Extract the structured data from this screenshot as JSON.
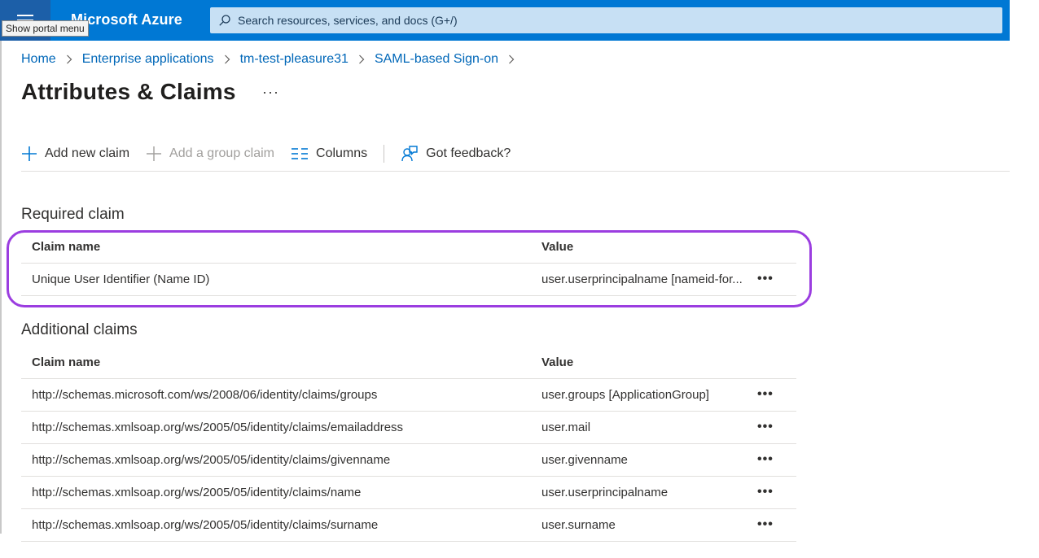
{
  "topbar": {
    "brand": "Microsoft Azure",
    "tooltip": "Show portal menu",
    "search_placeholder": "Search resources, services, and docs (G+/)"
  },
  "breadcrumb": [
    {
      "label": "Home"
    },
    {
      "label": "Enterprise applications"
    },
    {
      "label": "tm-test-pleasure31"
    },
    {
      "label": "SAML-based Sign-on"
    }
  ],
  "page": {
    "title": "Attributes & Claims",
    "more": "···"
  },
  "toolbar": {
    "add_new_claim": "Add new claim",
    "add_group_claim": "Add a group claim",
    "columns": "Columns",
    "feedback": "Got feedback?"
  },
  "required": {
    "label": "Required claim",
    "col_name": "Claim name",
    "col_value": "Value",
    "rows": [
      {
        "name": "Unique User Identifier (Name ID)",
        "value": "user.userprincipalname [nameid-for...",
        "more": "•••"
      }
    ]
  },
  "additional": {
    "label": "Additional claims",
    "col_name": "Claim name",
    "col_value": "Value",
    "rows": [
      {
        "name": "http://schemas.microsoft.com/ws/2008/06/identity/claims/groups",
        "value": "user.groups [ApplicationGroup]",
        "more": "•••"
      },
      {
        "name": "http://schemas.xmlsoap.org/ws/2005/05/identity/claims/emailaddress",
        "value": "user.mail",
        "more": "•••"
      },
      {
        "name": "http://schemas.xmlsoap.org/ws/2005/05/identity/claims/givenname",
        "value": "user.givenname",
        "more": "•••"
      },
      {
        "name": "http://schemas.xmlsoap.org/ws/2005/05/identity/claims/name",
        "value": "user.userprincipalname",
        "more": "•••"
      },
      {
        "name": "http://schemas.xmlsoap.org/ws/2005/05/identity/claims/surname",
        "value": "user.surname",
        "more": "•••"
      }
    ]
  },
  "colors": {
    "azure_blue": "#0078d4",
    "link": "#0067b8",
    "highlight": "#9b3de0"
  }
}
